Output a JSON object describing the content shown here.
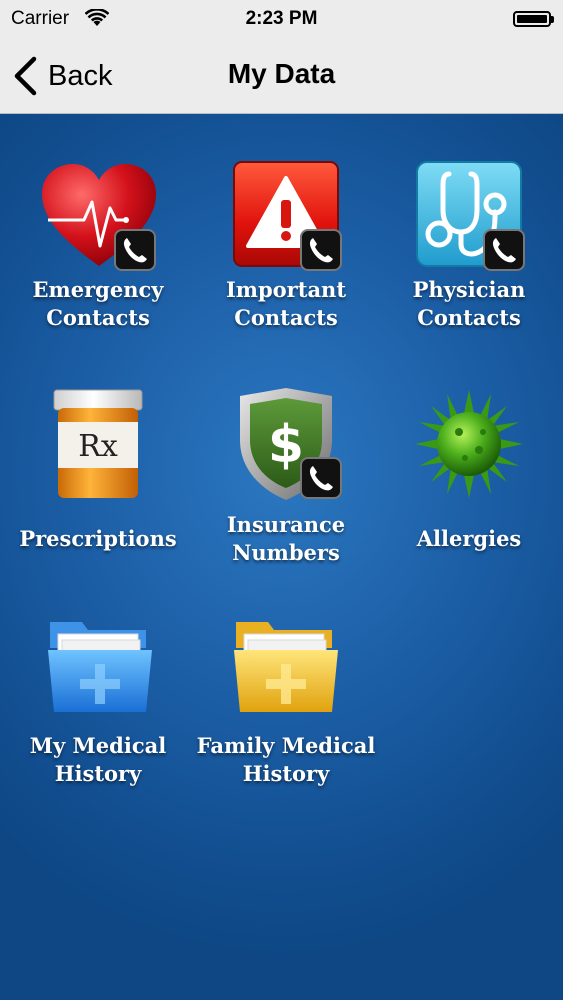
{
  "status": {
    "carrier": "Carrier",
    "time": "2:23 PM"
  },
  "nav": {
    "back_label": "Back",
    "title": "My Data"
  },
  "tiles": [
    {
      "line1": "Emergency",
      "line2": "Contacts"
    },
    {
      "line1": "Important",
      "line2": "Contacts"
    },
    {
      "line1": "Physician",
      "line2": "Contacts"
    },
    {
      "line1": "Prescriptions",
      "line2": ""
    },
    {
      "line1": "Insurance",
      "line2": "Numbers"
    },
    {
      "line1": "Allergies",
      "line2": ""
    },
    {
      "line1": "My Medical",
      "line2": "History"
    },
    {
      "line1": "Family Medical",
      "line2": "History"
    }
  ],
  "icons": {
    "rx_text": "Rx",
    "dollar_text": "$"
  },
  "colors": {
    "background_blue": "#1a5c9e",
    "nav_background": "#ececed",
    "label_text": "#ffffff"
  }
}
